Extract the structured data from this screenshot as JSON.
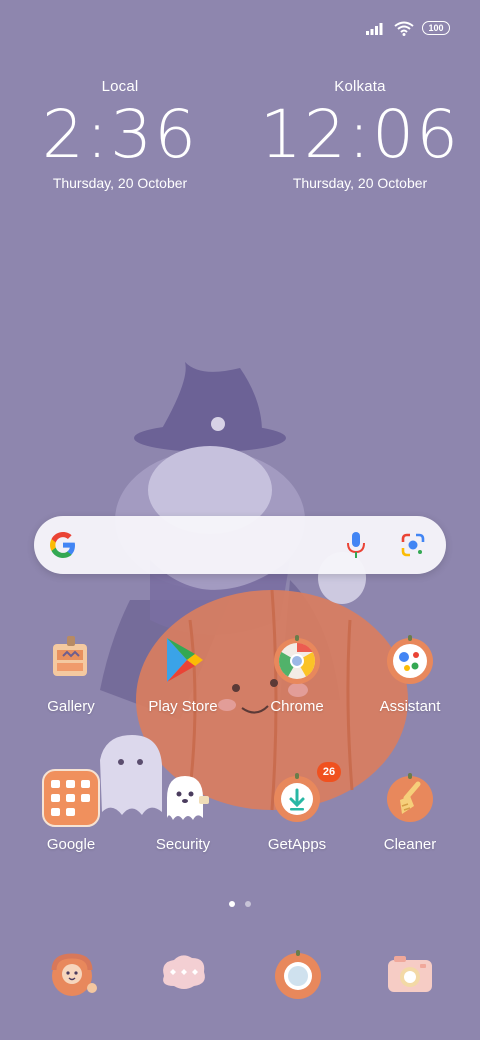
{
  "status_bar": {
    "battery": "100",
    "icons": [
      "signal-icon",
      "wifi-icon",
      "battery-icon"
    ]
  },
  "clocks": [
    {
      "city": "Local",
      "time": "2:36",
      "date": "Thursday, 20 October"
    },
    {
      "city": "Kolkata",
      "time": "12:06",
      "date": "Thursday, 20 October"
    }
  ],
  "search": {
    "icons": [
      "google-logo-icon",
      "microphone-icon",
      "google-lens-icon"
    ]
  },
  "apps": [
    {
      "label": "Gallery"
    },
    {
      "label": "Play Store"
    },
    {
      "label": "Chrome"
    },
    {
      "label": "Assistant"
    },
    {
      "label": "Google"
    },
    {
      "label": "Security"
    },
    {
      "label": "GetApps",
      "badge": "26"
    },
    {
      "label": "Cleaner"
    }
  ],
  "pager": {
    "pages": 2,
    "active": 1
  },
  "dock": {
    "icons": [
      "phone-icon",
      "messages-icon",
      "browser-icon",
      "camera-icon"
    ]
  },
  "colors": {
    "background": "#8e86ae",
    "pumpkin": "#e8885c",
    "badge": "#f0511f"
  }
}
